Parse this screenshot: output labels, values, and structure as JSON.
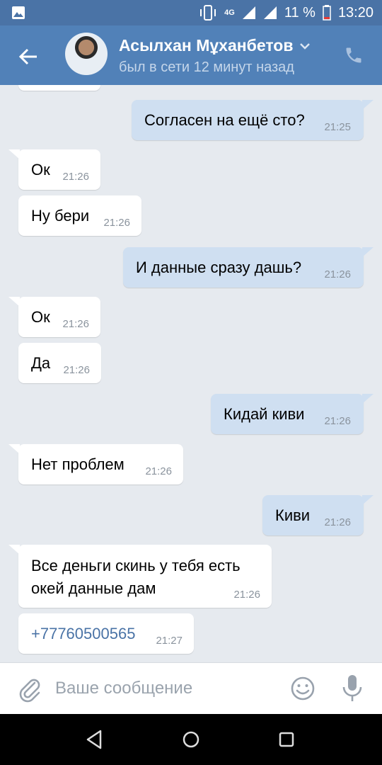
{
  "status_bar": {
    "network": "4G",
    "battery": "11 %",
    "time": "13:20",
    "icons": [
      "image-icon",
      "vibrate-icon",
      "signal-icon",
      "wifi-icon",
      "battery-icon"
    ]
  },
  "header": {
    "contact_name": "Асылхан Мұханбетов",
    "contact_status": "был в сети 12 минут назад",
    "icons": [
      "back-arrow-icon",
      "avatar",
      "chevron-down-icon",
      "phone-icon"
    ]
  },
  "messages": [
    {
      "id": "m0",
      "direction": "in",
      "text": "",
      "time": ""
    },
    {
      "id": "m1",
      "direction": "out",
      "text": "Согласен на ещё сто?",
      "time": "21:25"
    },
    {
      "id": "m2",
      "direction": "in",
      "text": "Ок",
      "time": "21:26"
    },
    {
      "id": "m3",
      "direction": "in",
      "text": "Ну бери",
      "time": "21:26"
    },
    {
      "id": "m4",
      "direction": "out",
      "text": "И данные сразу дашь?",
      "time": "21:26"
    },
    {
      "id": "m5",
      "direction": "in",
      "text": "Ок",
      "time": "21:26"
    },
    {
      "id": "m6",
      "direction": "in",
      "text": "Да",
      "time": "21:26"
    },
    {
      "id": "m7",
      "direction": "out",
      "text": "Кидай киви",
      "time": "21:26"
    },
    {
      "id": "m8",
      "direction": "in",
      "text": "Нет проблем",
      "time": "21:26"
    },
    {
      "id": "m9",
      "direction": "out",
      "text": "Киви",
      "time": "21:26"
    },
    {
      "id": "m10",
      "direction": "in",
      "text": "Все деньги скинь у тебя есть\nокей данные дам",
      "time": "21:26"
    },
    {
      "id": "m11",
      "direction": "in",
      "text": "+77760500565",
      "time": "21:27",
      "link": true
    }
  ],
  "input": {
    "placeholder": "Ваше сообщение",
    "value": "",
    "icons": [
      "paperclip-icon",
      "emoji-icon",
      "microphone-icon"
    ]
  },
  "nav": {
    "icons": [
      "back-triangle-icon",
      "home-circle-icon",
      "recents-square-icon"
    ]
  },
  "colors": {
    "status_bar": "#4a73a6",
    "header": "#5181b8",
    "chat_background": "#e6eaef",
    "incoming_bubble": "#ffffff",
    "outgoing_bubble": "#cfdff1",
    "link": "#4a73a6"
  }
}
